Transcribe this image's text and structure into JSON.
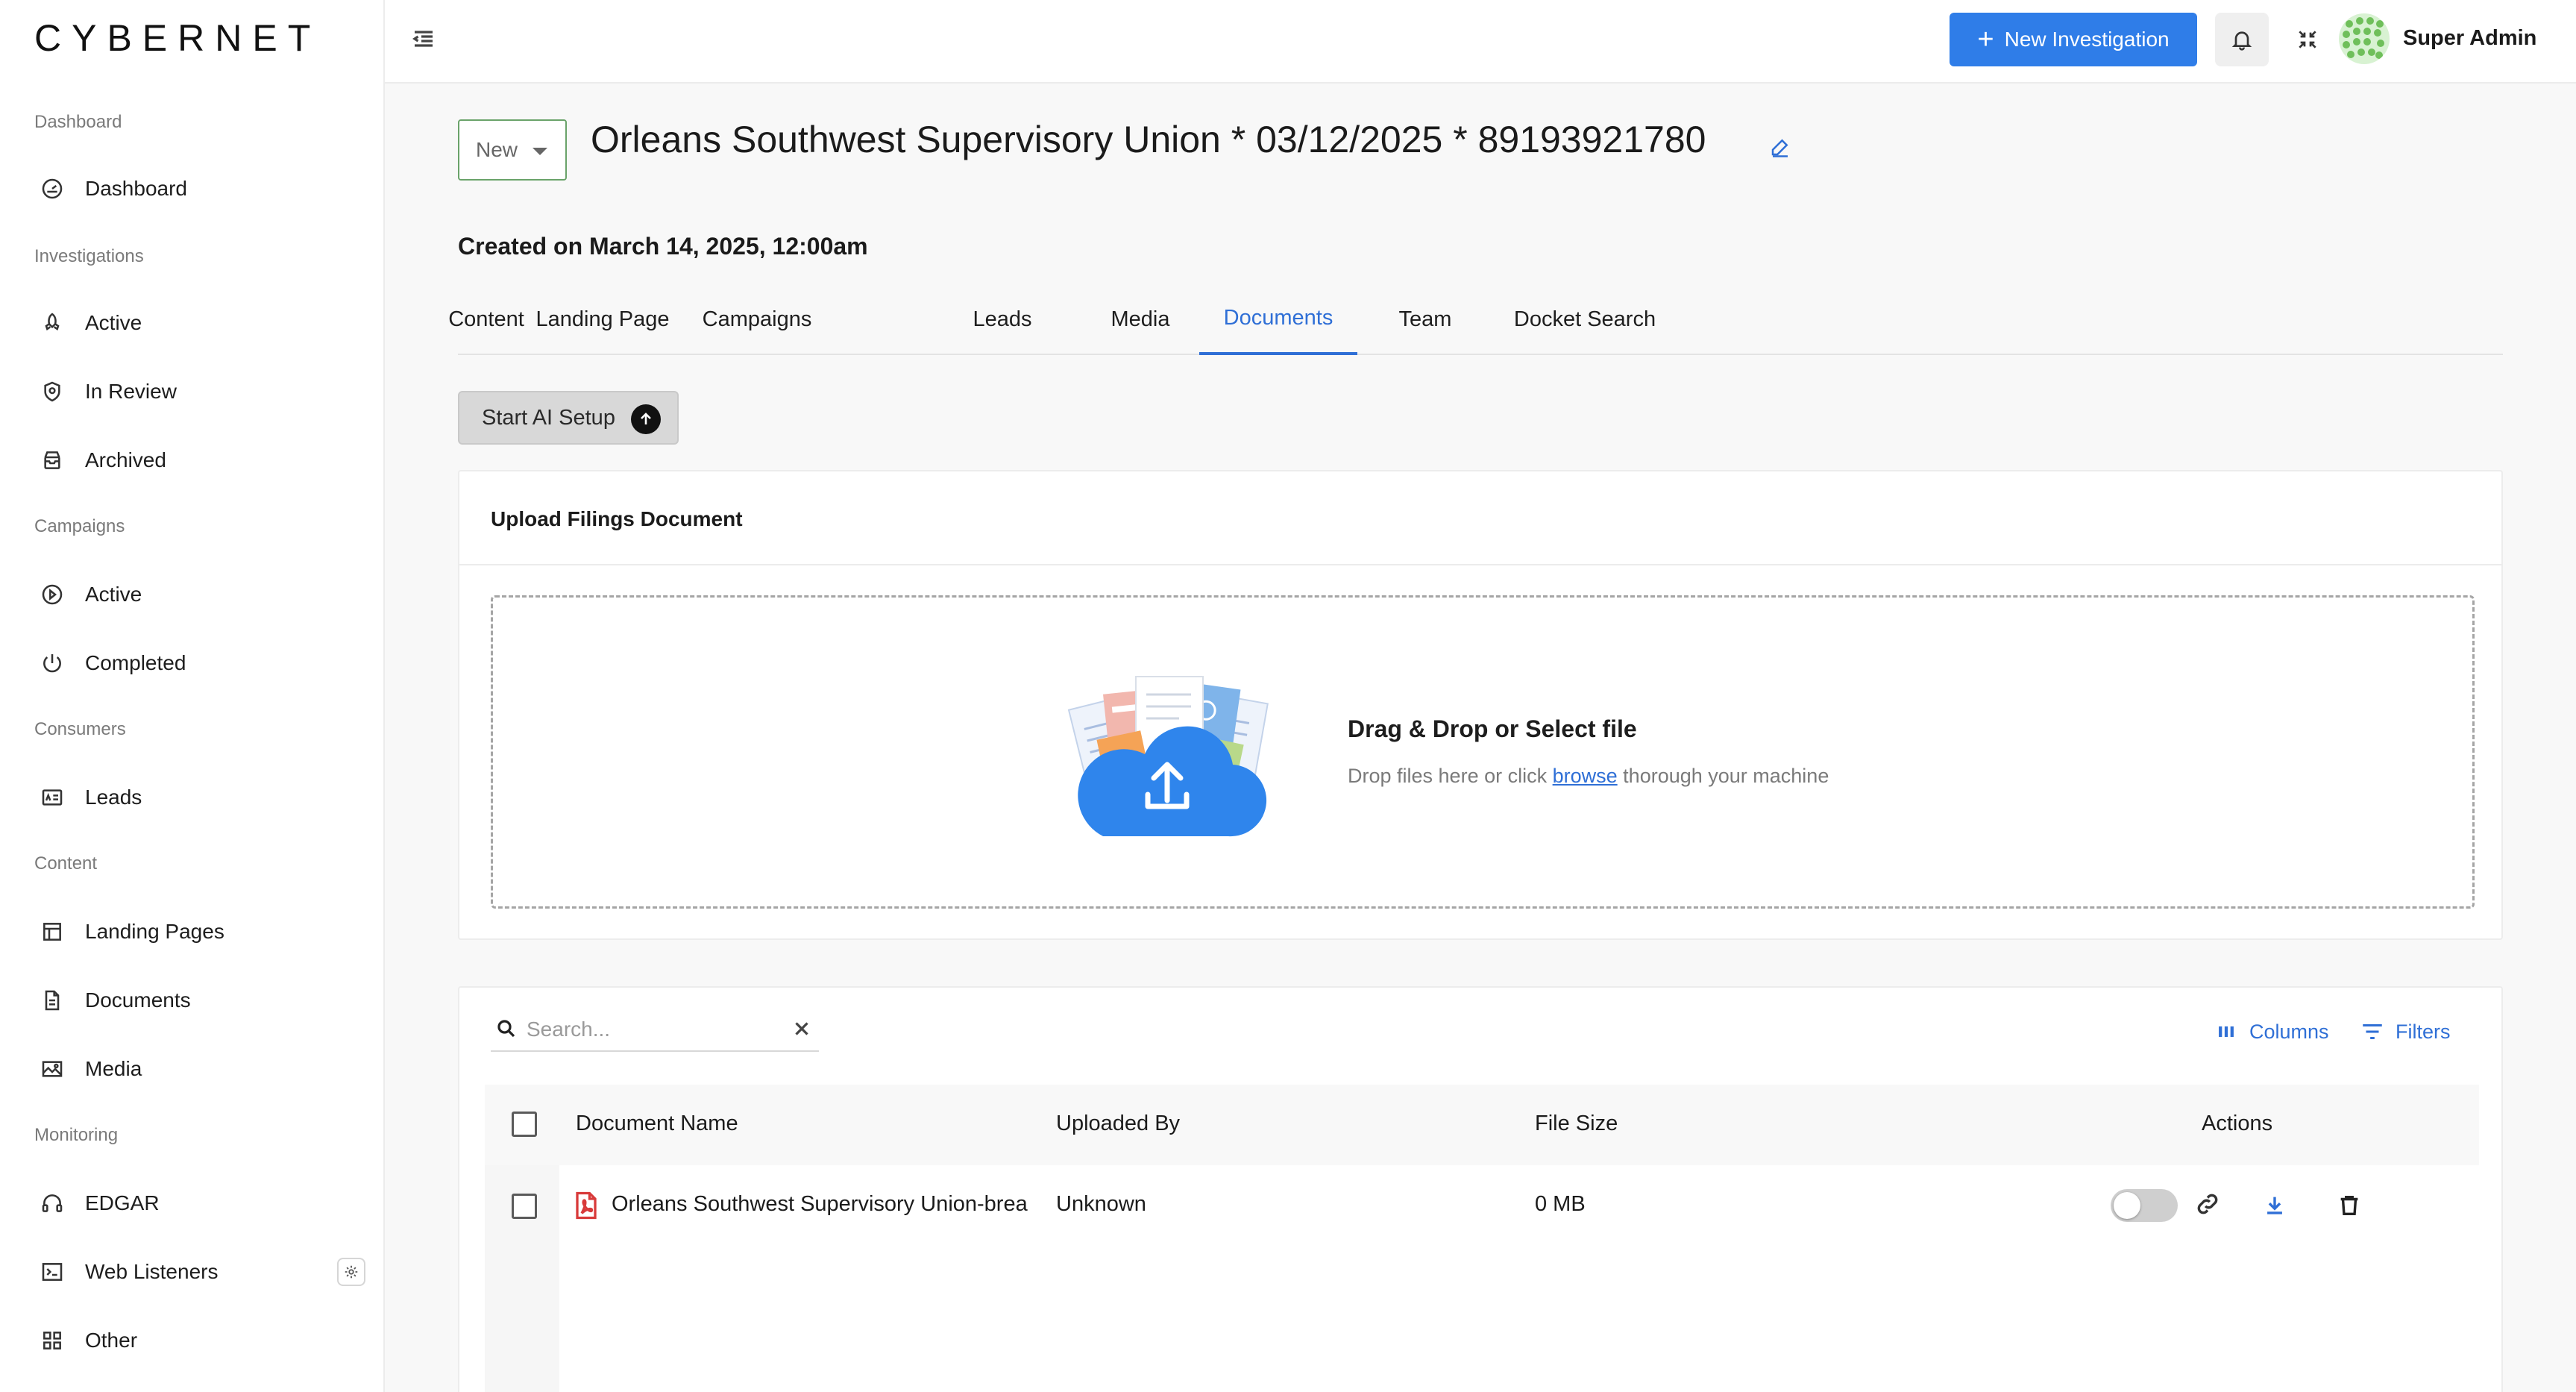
{
  "brand": {
    "logo_text": "CYBERNET"
  },
  "sidebar": {
    "sections": [
      {
        "label": "Dashboard",
        "items": [
          {
            "label": "Dashboard",
            "icon": "gauge-icon"
          }
        ]
      },
      {
        "label": "Investigations",
        "items": [
          {
            "label": "Active",
            "icon": "rocket-icon"
          },
          {
            "label": "In Review",
            "icon": "shield-icon"
          },
          {
            "label": "Archived",
            "icon": "archive-icon"
          }
        ]
      },
      {
        "label": "Campaigns",
        "items": [
          {
            "label": "Active",
            "icon": "play-circle-icon"
          },
          {
            "label": "Completed",
            "icon": "power-icon"
          }
        ]
      },
      {
        "label": "Consumers",
        "items": [
          {
            "label": "Leads",
            "icon": "id-card-icon"
          }
        ]
      },
      {
        "label": "Content",
        "items": [
          {
            "label": "Landing Pages",
            "icon": "layout-icon"
          },
          {
            "label": "Documents",
            "icon": "file-text-icon"
          },
          {
            "label": "Media",
            "icon": "image-icon"
          }
        ]
      },
      {
        "label": "Monitoring",
        "items": [
          {
            "label": "EDGAR",
            "icon": "headphones-icon"
          },
          {
            "label": "Web Listeners",
            "icon": "terminal-icon"
          },
          {
            "label": "Other",
            "icon": "grid-icon"
          }
        ]
      }
    ]
  },
  "topbar": {
    "new_investigation_label": "New Investigation",
    "user_name": "Super Admin",
    "accent_color": "#2f7de8"
  },
  "investigation": {
    "status": "New",
    "title": "Orleans Southwest Supervisory Union * 03/12/2025 * 89193921780",
    "created_on": "Created on March 14, 2025, 12:00am"
  },
  "tabs": [
    {
      "label": "Content",
      "active": false
    },
    {
      "label": "Landing Page",
      "active": false
    },
    {
      "label": "Campaigns",
      "active": false
    },
    {
      "label": "Leads",
      "active": false
    },
    {
      "label": "Media",
      "active": false
    },
    {
      "label": "Documents",
      "active": true
    },
    {
      "label": "Team",
      "active": false
    },
    {
      "label": "Docket Search",
      "active": false
    }
  ],
  "ai_setup_label": "Start AI Setup",
  "upload": {
    "title": "Upload Filings Document",
    "drop_title": "Drag & Drop or Select file",
    "drop_sub_before": "Drop files here or click",
    "drop_sub_link": "browse",
    "drop_sub_after": "thorough your machine"
  },
  "table": {
    "search_placeholder": "Search...",
    "columns_label": "Columns",
    "filters_label": "Filters",
    "headers": {
      "name": "Document Name",
      "uploaded_by": "Uploaded By",
      "file_size": "File Size",
      "actions": "Actions"
    },
    "rows": [
      {
        "name": "Orleans Southwest Supervisory Union-brea",
        "uploaded_by": "Unknown",
        "file_size": "0 MB",
        "public": false
      }
    ]
  }
}
